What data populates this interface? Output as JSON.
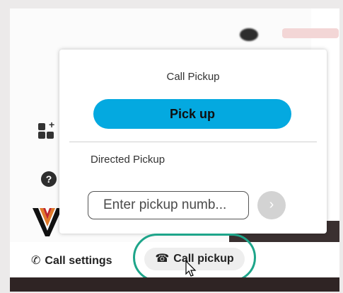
{
  "popup": {
    "title": "Call Pickup",
    "pickup_button_label": "Pick up",
    "directed_label": "Directed Pickup",
    "input_placeholder": "Enter pickup numb..."
  },
  "bottom_bar": {
    "call_settings_label": "Call settings",
    "call_pickup_label": "Call pickup"
  },
  "colors": {
    "accent_blue": "#04a9e0",
    "highlight_green": "#1ea58a"
  },
  "icons": [
    "apps-add-icon",
    "help-icon",
    "chevron-right-icon",
    "call-settings-icon",
    "call-pickup-icon",
    "cursor-icon"
  ]
}
